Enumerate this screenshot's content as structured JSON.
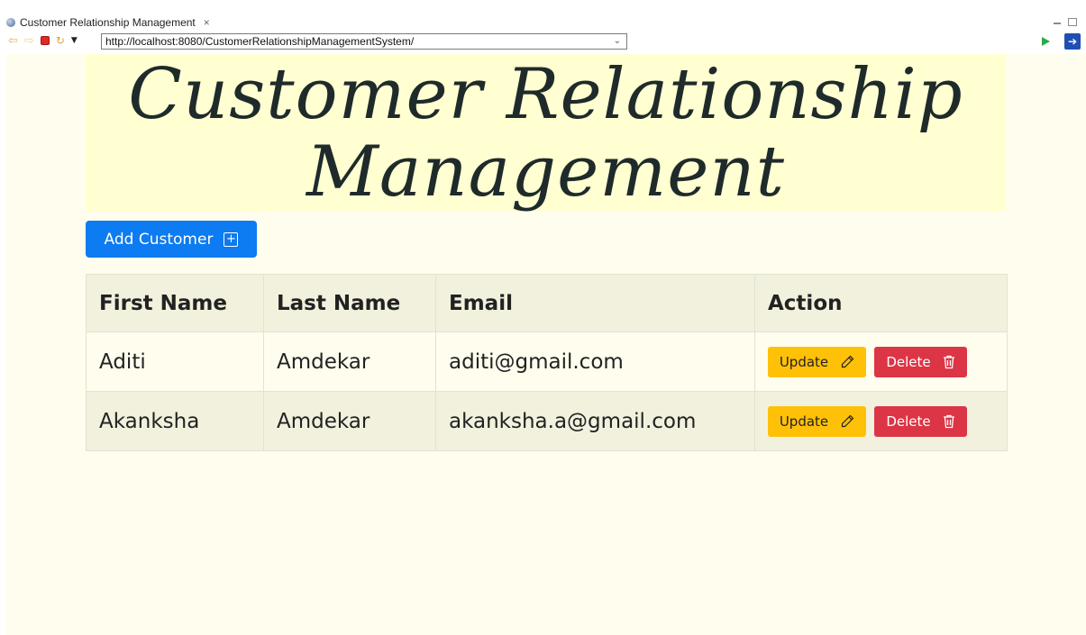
{
  "browser": {
    "tab_title": "Customer Relationship Management",
    "tab_close": "×",
    "url": "http://localhost:8080/CustomerRelationshipManagementSystem/"
  },
  "page": {
    "title_line1": "Customer Relationship",
    "title_line2": "Management",
    "add_button_label": "Add Customer",
    "colors": {
      "page_bg": "#fffeee",
      "hero_bg": "#ffffd2",
      "primary": "#0d7bf2",
      "warning": "#ffc107",
      "danger": "#dc3545"
    }
  },
  "table": {
    "headers": [
      "First Name",
      "Last Name",
      "Email",
      "Action"
    ],
    "rows": [
      {
        "first_name": "Aditi",
        "last_name": "Amdekar",
        "email": "aditi@gmail.com",
        "update": "Update",
        "delete": "Delete"
      },
      {
        "first_name": "Akanksha",
        "last_name": "Amdekar",
        "email": "akanksha.a@gmail.com",
        "update": "Update",
        "delete": "Delete"
      }
    ]
  },
  "icons": {
    "tab": "globe-icon",
    "back": "back-arrow-icon",
    "forward": "forward-arrow-icon",
    "stop": "stop-icon",
    "refresh": "refresh-icon",
    "add": "plus-square-icon",
    "update": "pencil-icon",
    "delete": "trash-icon"
  }
}
